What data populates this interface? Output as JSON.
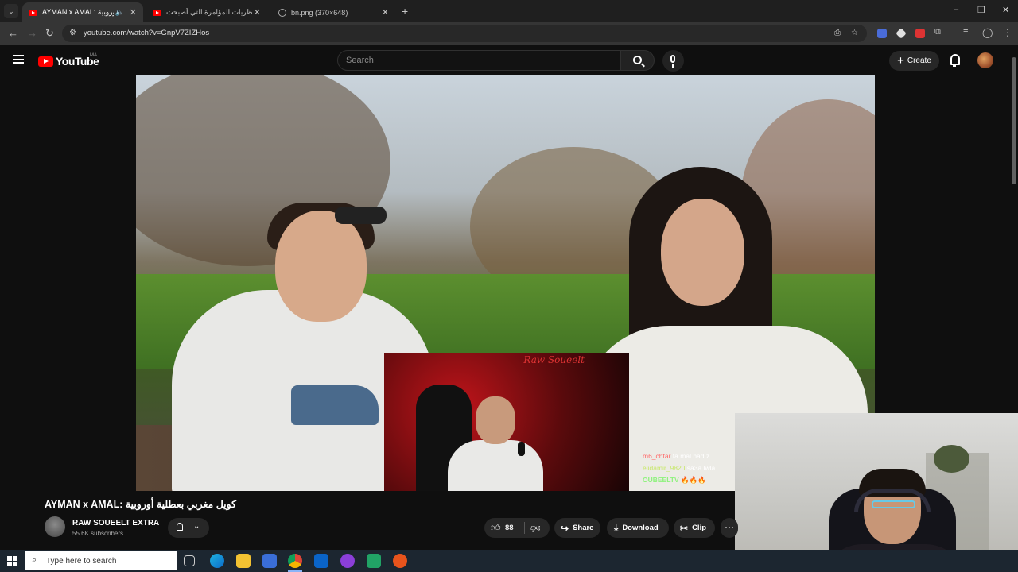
{
  "browser": {
    "tabs": [
      {
        "title": "AYMAN x AMAL: كويل مغربي بعطلية أوروبية",
        "active": true,
        "muted": true
      },
      {
        "title": "أبرز نظريات المؤامرة التي أصبحت",
        "active": false
      },
      {
        "title": "bn.png (370×648)",
        "active": false
      }
    ],
    "new_tab": "+",
    "url": "youtube.com/watch?v=GnpV7ZIZHos",
    "window_controls": {
      "minimize": "–",
      "restore": "❐",
      "close": "✕"
    }
  },
  "youtube": {
    "logo_text": "YouTube",
    "country_code": "MA",
    "search_placeholder": "Search",
    "create_label": "Create"
  },
  "video": {
    "title": "AYMAN x AMAL: كويل مغربي بعطلية أوروبية",
    "channel": "RAW SOUEELT EXTRA",
    "subscribers": "55.6K subscribers",
    "likes": "88",
    "actions": {
      "share": "Share",
      "download": "Download",
      "clip": "Clip",
      "more": "···"
    },
    "overlay_watermark": "Raw Soueelt",
    "chat": [
      {
        "user": "m6_chfar",
        "message": "ta mal had z"
      },
      {
        "user": "elidamir_9820",
        "message": "sa3a lwla"
      },
      {
        "user": "OUBEELTV",
        "message": "🔥🔥🔥"
      }
    ]
  },
  "taskbar": {
    "search_placeholder": "Type here to search"
  },
  "colors": {
    "yt_red": "#ff0000",
    "background": "#0f0f0f",
    "pill": "#272727"
  }
}
